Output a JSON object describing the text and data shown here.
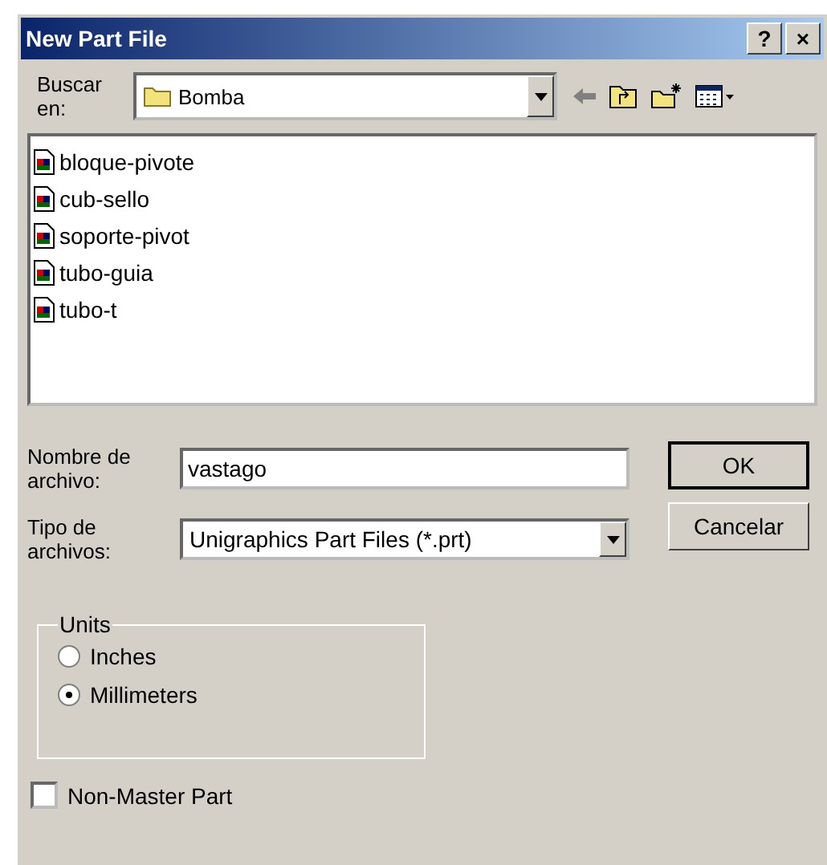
{
  "window": {
    "title": "New Part File",
    "help_button": "?",
    "close_button": "×"
  },
  "look_in": {
    "label": "Buscar en:",
    "value": "Bomba"
  },
  "files": [
    {
      "name": "bloque-pivote"
    },
    {
      "name": "cub-sello"
    },
    {
      "name": "soporte-pivot"
    },
    {
      "name": "tubo-guia"
    },
    {
      "name": "tubo-t"
    }
  ],
  "file_name": {
    "label": "Nombre de archivo:",
    "value": "vastago"
  },
  "file_type": {
    "label": "Tipo de archivos:",
    "value": "Unigraphics Part Files (*.prt)"
  },
  "buttons": [
    {
      "label": "OK",
      "default": true
    },
    {
      "label": "Cancelar",
      "default": false
    }
  ],
  "units": {
    "title": "Units",
    "options": [
      {
        "label": "Inches",
        "selected": false
      },
      {
        "label": "Millimeters",
        "selected": true
      }
    ]
  },
  "non_master": {
    "label": "Non-Master Part",
    "checked": false
  }
}
